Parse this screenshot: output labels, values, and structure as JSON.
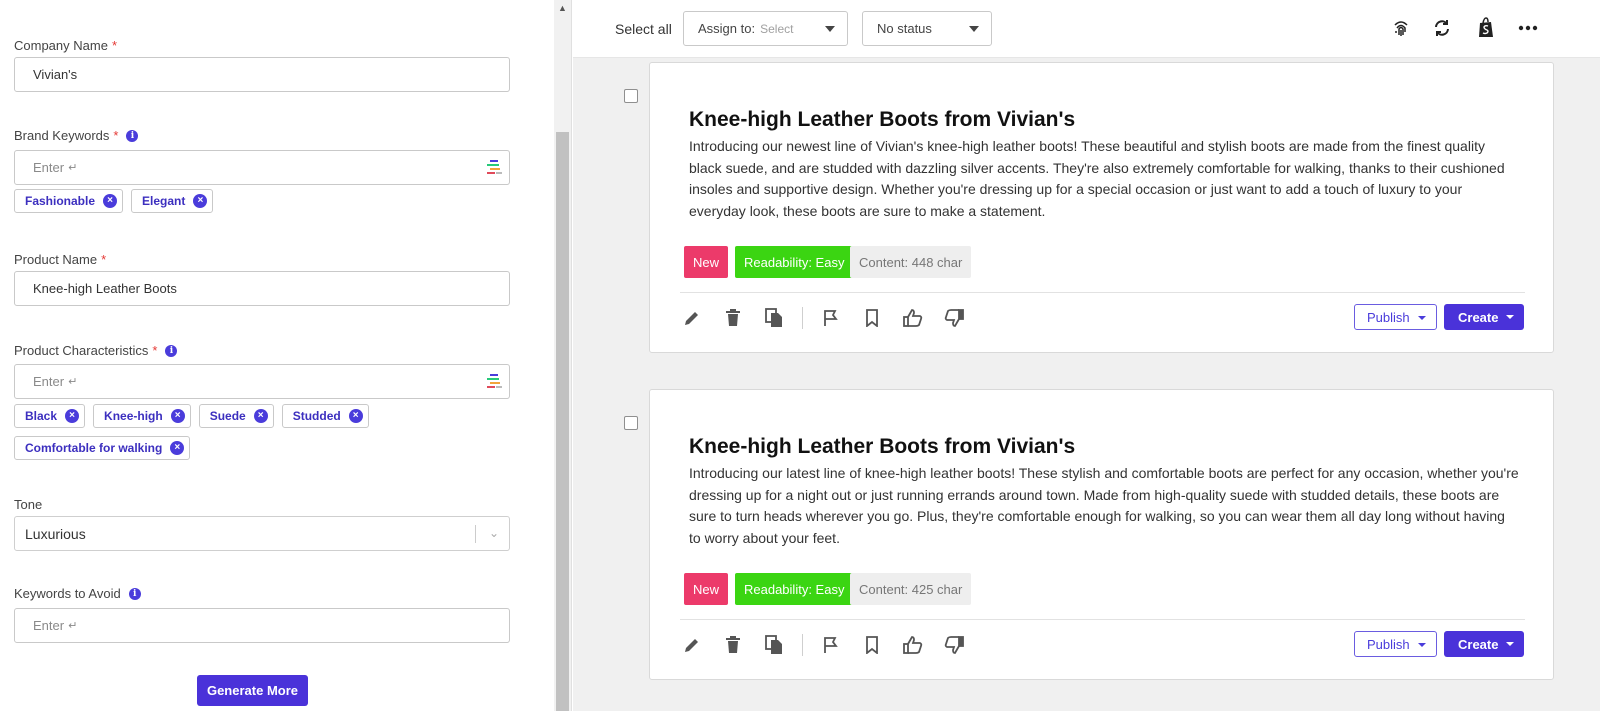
{
  "form": {
    "company": {
      "label": "Company Name",
      "required": "*",
      "value": "Vivian's"
    },
    "brand_keywords": {
      "label": "Brand Keywords",
      "required": "*",
      "placeholder": "Enter",
      "tags": [
        "Fashionable",
        "Elegant"
      ]
    },
    "product_name": {
      "label": "Product Name",
      "required": "*",
      "value": "Knee-high Leather Boots"
    },
    "product_characteristics": {
      "label": "Product Characteristics",
      "required": "*",
      "placeholder": "Enter",
      "tags": [
        "Black",
        "Knee-high",
        "Suede",
        "Studded",
        "Comfortable for walking"
      ]
    },
    "tone": {
      "label": "Tone",
      "value": "Luxurious"
    },
    "keywords_to_avoid": {
      "label": "Keywords to Avoid",
      "placeholder": "Enter"
    },
    "generate_label": "Generate More",
    "return_glyph": "↵"
  },
  "toolbar": {
    "select_all": "Select all",
    "assign_label": "Assign to:",
    "assign_value": "Select",
    "status_value": "No status"
  },
  "cards": [
    {
      "title": "Knee-high Leather Boots from Vivian's",
      "body": "Introducing our newest line of Vivian's knee-high leather boots! These beautiful and stylish boots are made from the finest quality black suede, and are studded with dazzling silver accents. They're also extremely comfortable for walking, thanks to their cushioned insoles and supportive design. Whether you're dressing up for a special occasion or just want to add a touch of luxury to your everyday look, these boots are sure to make a statement.",
      "badge_new": "New",
      "badge_readability": "Readability: Easy",
      "badge_content": "Content: 448 char",
      "publish": "Publish",
      "create": "Create"
    },
    {
      "title": "Knee-high Leather Boots from Vivian's",
      "body": "Introducing our latest line of knee-high leather boots! These stylish and comfortable boots are perfect for any occasion, whether you're dressing up for a night out or just running errands around town. Made from high-quality suede with studded details, these boots are sure to turn heads wherever you go. Plus, they're comfortable enough for walking, so you can wear them all day long without having to worry about your feet.",
      "badge_new": "New",
      "badge_readability": "Readability: Easy",
      "badge_content": "Content: 425 char",
      "publish": "Publish",
      "create": "Create"
    }
  ],
  "colors": {
    "accent": "#4a32d9",
    "new_badge": "#ec3a6a",
    "readability_badge": "#3bd512"
  }
}
